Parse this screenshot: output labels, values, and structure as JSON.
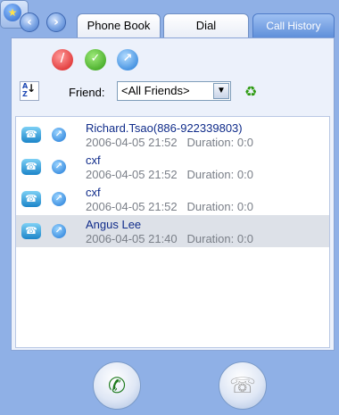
{
  "nav": {
    "back_glyph": "◀",
    "forward_glyph": "▶"
  },
  "tabs": [
    {
      "label": "Phone Book"
    },
    {
      "label": "Dial"
    },
    {
      "label": "Call History"
    }
  ],
  "toolbar": {
    "icons": [
      "favorites-icon",
      "delete-icon",
      "check-icon",
      "outgoing-call-icon"
    ]
  },
  "filter": {
    "sort_glyph_top": "A",
    "sort_glyph_bottom": "Z",
    "friend_label": "Friend:",
    "friend_value": "<All Friends>"
  },
  "calls": [
    {
      "name": "Richard.Tsao(886-922339803)",
      "datetime": "2006-04-05 21:52",
      "duration": "Duration: 0:0"
    },
    {
      "name": "cxf",
      "datetime": "2006-04-05 21:52",
      "duration": "Duration: 0:0"
    },
    {
      "name": "cxf",
      "datetime": "2006-04-05 21:52",
      "duration": "Duration: 0:0"
    },
    {
      "name": "Angus Lee",
      "datetime": "2006-04-05 21:40",
      "duration": "Duration: 0:0"
    }
  ],
  "colors": {
    "background": "#8fb0e6",
    "active_tab": "#5f8fda",
    "name_text": "#102c8a",
    "meta_text": "#7a7f88"
  }
}
